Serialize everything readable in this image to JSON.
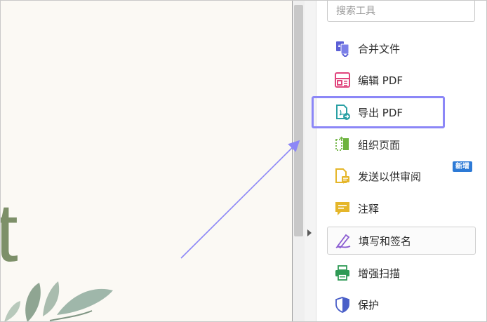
{
  "document": {
    "visible_letter": "t"
  },
  "tools_panel": {
    "search_placeholder": "搜索工具",
    "new_badge": "新增",
    "tools": [
      {
        "label": "合并文件",
        "icon": "combine-files-icon"
      },
      {
        "label": "编辑 PDF",
        "icon": "edit-pdf-icon"
      },
      {
        "label": "导出 PDF",
        "icon": "export-pdf-icon"
      },
      {
        "label": "组织页面",
        "icon": "organize-pages-icon"
      },
      {
        "label": "发送以供审阅",
        "icon": "send-for-review-icon"
      },
      {
        "label": "注释",
        "icon": "comment-icon"
      },
      {
        "label": "填写和签名",
        "icon": "fill-and-sign-icon"
      },
      {
        "label": "增强扫描",
        "icon": "enhance-scans-icon"
      },
      {
        "label": "保护",
        "icon": "protect-icon"
      }
    ]
  },
  "colors": {
    "annotation": "#8c87f7",
    "badge": "#2d7ad6",
    "combine": "#5b5fd6",
    "edit": "#e0447c",
    "export": "#2aa0a4",
    "organize": "#6db33f",
    "review": "#e5b62a",
    "comment": "#e5b62a",
    "sign": "#8a5cd1",
    "scan": "#2f9a55",
    "protect": "#4a5fc8"
  }
}
